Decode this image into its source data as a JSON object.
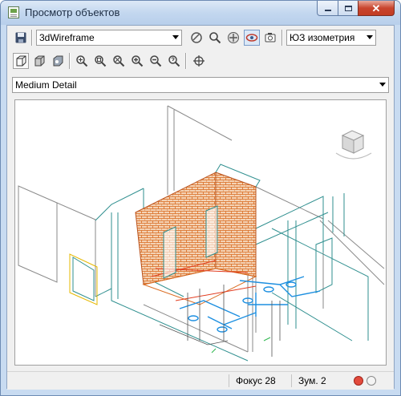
{
  "window": {
    "title": "Просмотр объектов"
  },
  "toolbar": {
    "visual_style": "3dWireframe",
    "view": "ЮЗ изометрия"
  },
  "detail_level": "Medium Detail",
  "statusbar": {
    "focus": "Фокус 28",
    "zoom": "Зум. 2"
  },
  "colors": {
    "brick": "#d9691d",
    "duct": "#1d8fe0",
    "wall_teal": "#2f8f8f",
    "close_red": "#e24a3c"
  },
  "icons": {
    "save": "save-icon",
    "orbit": "orbit-icon",
    "zoom": "zoom-icon",
    "pan": "pan-icon",
    "view_cube": "view-cube-icon"
  }
}
